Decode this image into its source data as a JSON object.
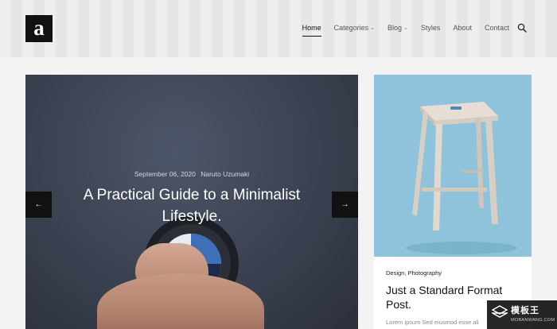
{
  "logo": {
    "letter": "a"
  },
  "nav": {
    "items": [
      {
        "label": "Home",
        "active": true,
        "dropdown": false
      },
      {
        "label": "Categories",
        "active": false,
        "dropdown": true
      },
      {
        "label": "Blog",
        "active": false,
        "dropdown": true
      },
      {
        "label": "Styles",
        "active": false,
        "dropdown": false
      },
      {
        "label": "About",
        "active": false,
        "dropdown": false
      },
      {
        "label": "Contact",
        "active": false,
        "dropdown": false
      }
    ],
    "chevron": "⌄",
    "search_icon": "search-icon"
  },
  "hero": {
    "date": "September 06, 2020",
    "author": "Naruto Uzumaki",
    "title": "A Practical Guide to a Minimalist Lifestyle.",
    "prev_arrow": "←",
    "next_arrow": "→"
  },
  "card": {
    "categories": "Design, Photography",
    "title": "Just a Standard Format Post.",
    "excerpt": "Lorem ipsum Sed eiusmod esse ali"
  },
  "watermark": {
    "text": "模板王",
    "sub": "MOBANWANG.COM"
  },
  "colors": {
    "hero_bg": "#3a4150",
    "card_img_bg": "#8fc3dc",
    "accent": "#111111"
  }
}
